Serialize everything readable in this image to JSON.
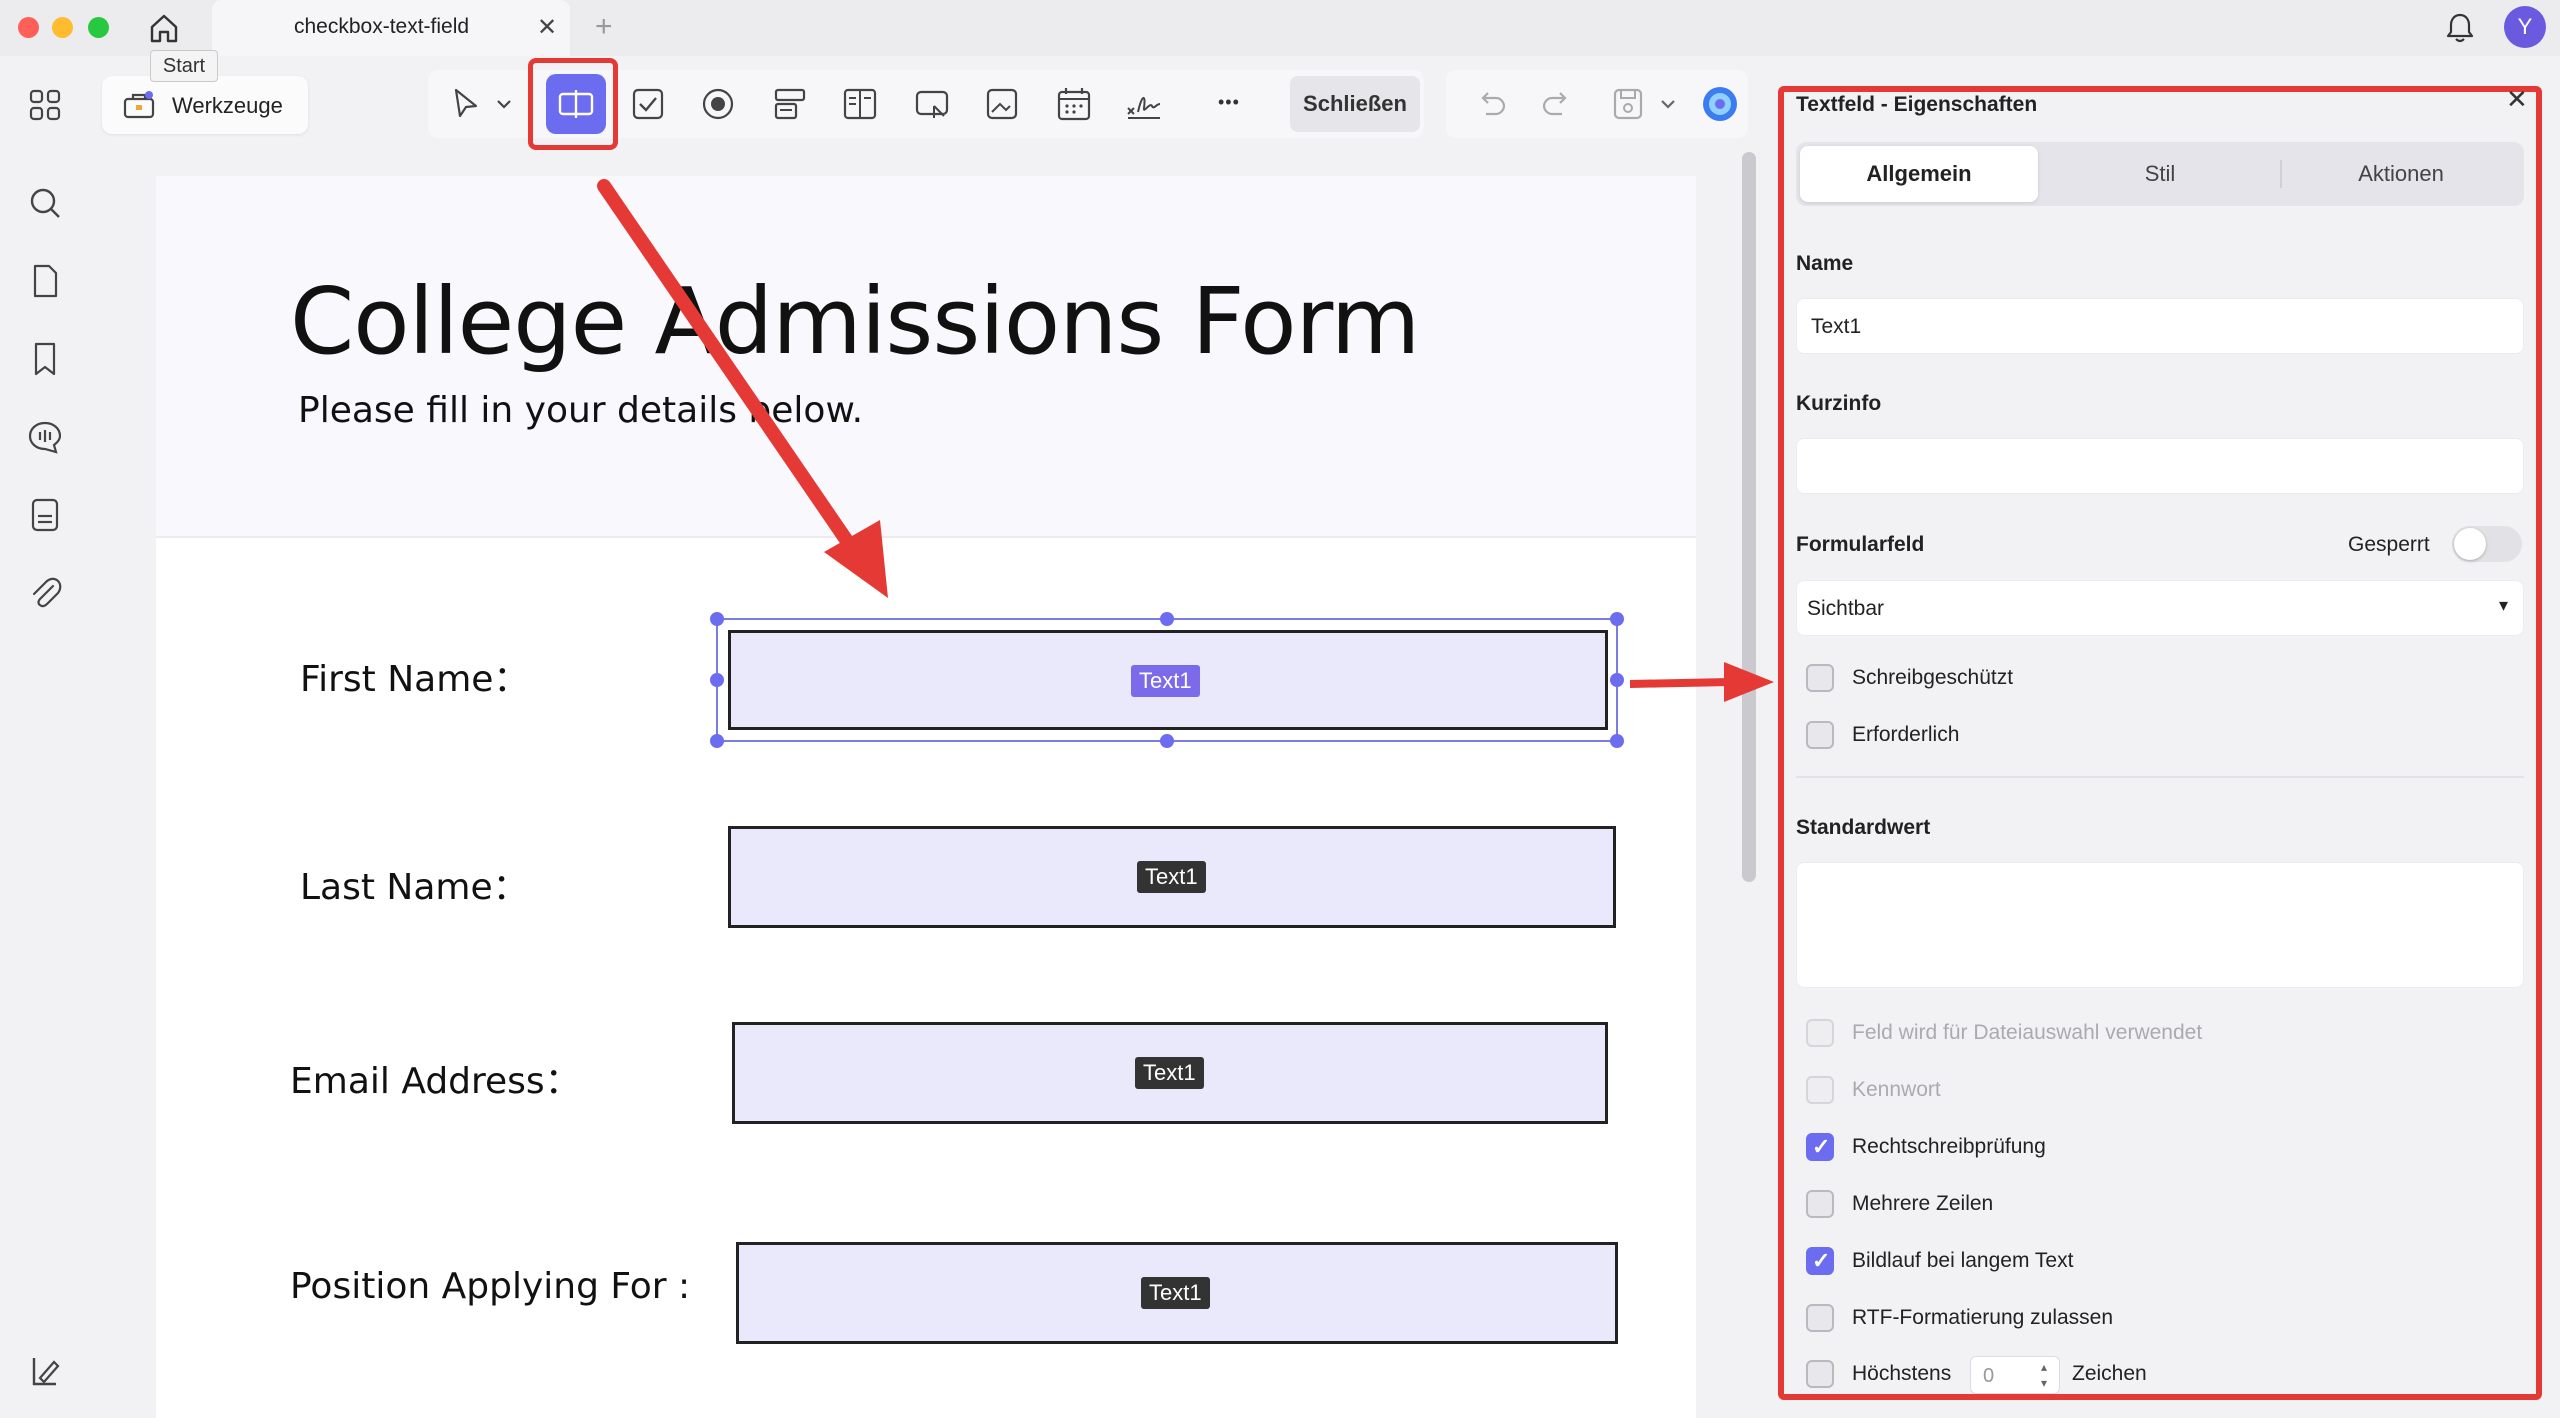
{
  "window": {
    "tab_title": "checkbox-text-field",
    "tab_close": "✕",
    "tab_add": "+",
    "avatar_letter": "Y",
    "tooltip": "Start"
  },
  "toolbar": {
    "tools_label": "Werkzeuge",
    "close_label": "Schließen",
    "more": "•••"
  },
  "document": {
    "title": "College Admissions Form",
    "subtitle": "Please fill in your details below.",
    "fields": [
      {
        "label": "First Name：",
        "tag": "Text1"
      },
      {
        "label": "Last Name：",
        "tag": "Text1"
      },
      {
        "label": "Email Address：",
        "tag": "Text1"
      },
      {
        "label": "Position Applying For :",
        "tag": "Text1"
      }
    ]
  },
  "panel": {
    "title": "Textfeld - Eigenschaften",
    "close": "✕",
    "tabs": [
      "Allgemein",
      "Stil",
      "Aktionen"
    ],
    "name_label": "Name",
    "name_value": "Text1",
    "tooltip_label": "Kurzinfo",
    "tooltip_value": "",
    "formfield_label": "Formularfeld",
    "locked_label": "Gesperrt",
    "locked": false,
    "visibility": "Sichtbar",
    "caret": "▾",
    "readonly_label": "Schreibgeschützt",
    "required_label": "Erforderlich",
    "default_label": "Standardwert",
    "default_value": "",
    "options": [
      {
        "label": "Feld wird für Dateiauswahl verwendet",
        "checked": false,
        "disabled": true
      },
      {
        "label": "Kennwort",
        "checked": false,
        "disabled": true
      },
      {
        "label": "Rechtschreibprüfung",
        "checked": true,
        "disabled": false
      },
      {
        "label": "Mehrere Zeilen",
        "checked": false,
        "disabled": false
      },
      {
        "label": "Bildlauf bei langem Text",
        "checked": true,
        "disabled": false
      },
      {
        "label": "RTF-Formatierung zulassen",
        "checked": false,
        "disabled": false
      }
    ],
    "max_label": "Höchstens",
    "max_value": "0",
    "max_unit": "Zeichen",
    "check_glyph": "✓",
    "spin_glyph": "▴\n▾"
  },
  "colors": {
    "accent": "#6b6cf0",
    "annotation": "#e53935",
    "field_fill": "#e9e9fb"
  }
}
